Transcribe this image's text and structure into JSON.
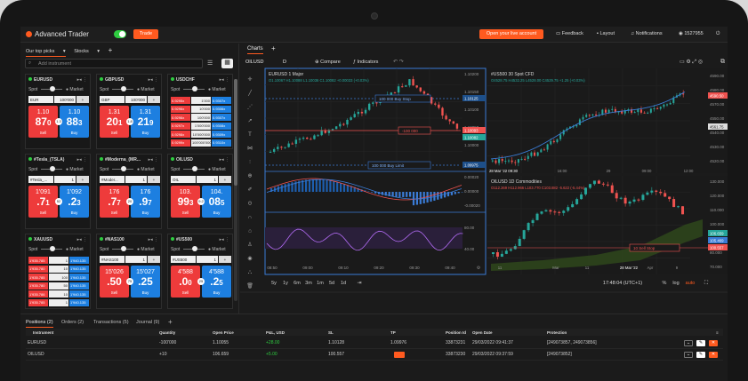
{
  "topbar": {
    "brand": "Advanced Trader",
    "trade_btn": "Trade",
    "live_btn": "Open your live account",
    "feedback": "Feedback",
    "layout": "Layout",
    "notifications": "Notifications",
    "account": "1527955"
  },
  "left": {
    "tab1": "Our top picks",
    "tab2": "Stocks",
    "search_placeholder": "Add instrument"
  },
  "cards": [
    {
      "name": "EURUSD",
      "amt": "EUR",
      "qty": "100'000",
      "sell1": "1.10",
      "sell2": "87",
      "sell3": "0",
      "buy1": "1.10",
      "buy2": "88",
      "buy3": "3",
      "spread": "1.3"
    },
    {
      "name": "GBPUSD",
      "amt": "GBP",
      "qty": "100'000",
      "sell1": "1.31",
      "sell2": "20",
      "sell3": "1",
      "buy1": "1.31",
      "buy2": "21",
      "buy3": "9",
      "spread": "1.8"
    },
    {
      "name": "USDCHF",
      "ladder": true
    },
    {
      "name": "#Tesla_(TSLA)",
      "amt": "#Tesla_...",
      "qty": "1",
      "sell1": "1'091",
      "sell2": ".7",
      "sell3": "1",
      "buy1": "1'092",
      "buy2": ".2",
      "buy3": "3",
      "spread": "52"
    },
    {
      "name": "#Moderna_(MR...",
      "amt": "#Moder...",
      "qty": "1",
      "sell1": "176",
      "sell2": ".7",
      "sell3": "7",
      "buy1": "176",
      "buy2": ".9",
      "buy3": "7",
      "spread": "20"
    },
    {
      "name": "OILUSD",
      "amt": "OIL",
      "qty": "1",
      "sell1": "103.",
      "sell2": "99",
      "sell3": "3",
      "buy1": "104.",
      "buy2": "08",
      "buy3": "5",
      "spread": "9.2"
    },
    {
      "name": "XAUUSD",
      "ladder": true
    },
    {
      "name": "#NAS100",
      "amt": "#NAS100",
      "qty": "1",
      "sell1": "15'026",
      "sell2": ".50",
      "sell3": "",
      "buy1": "15'027",
      "buy2": ".25",
      "buy3": "",
      "spread": "75"
    },
    {
      "name": "#US500",
      "amt": "#US500",
      "qty": "1",
      "sell1": "4'588",
      "sell2": ".0",
      "sell3": "0",
      "buy1": "4'588",
      "buy2": ".2",
      "buy3": "5",
      "spread": "25"
    }
  ],
  "ladder_usdchf": [
    [
      "0.9295x",
      "1'000",
      "0.9307x"
    ],
    [
      "0.9296x",
      "10'000",
      "0.9306x"
    ],
    [
      "0.9296x",
      "100'000",
      "0.9307x"
    ],
    [
      "0.9297x",
      "1'000'000",
      "0.9308x"
    ],
    [
      "0.9298x",
      "10'000'000",
      "0.9309x"
    ],
    [
      "0.9299x",
      "100'000'000",
      "0.9310x"
    ]
  ],
  "ladder_xau": [
    [
      "1'935.785",
      "1",
      "1'940.135"
    ],
    [
      "1'935.780",
      "10",
      "1'940.135"
    ],
    [
      "1'935.785",
      "100",
      "1'940.135"
    ],
    [
      "1'935.780",
      "50",
      "1'940.135"
    ],
    [
      "1'935.786",
      "10",
      "1'940.135"
    ],
    [
      "1'935.785",
      "1",
      "1'940.135"
    ]
  ],
  "charts_tab": "Charts",
  "toolbar": {
    "symbol": "OILUSD",
    "interval": "D",
    "compare": "Compare",
    "indicators": "Indicators"
  },
  "chart1": {
    "title": "EURUSD  1  Major",
    "ohlc": "O1.10067 H1.10088 L1.10036 C1.10082 +0.00033 (+0.03%)",
    "buy_stop": "100 000  Buy Stop",
    "limit": "-100 000",
    "buy_limit": "100 000  Buy Limit",
    "yaxis": [
      "1.10200",
      "1.10150",
      "1.10100",
      "1.10050",
      "1.10000",
      "1.09950"
    ],
    "xaxis": [
      "08:50",
      "09:00",
      "09:10",
      "09:20",
      "09:30",
      "09:40"
    ],
    "tag_a": "1.10125",
    "tag_b": "1.10093",
    "tag_c": "1.10082",
    "tag_d": "1.09975",
    "macd_y": [
      "0.00020",
      "0.00000",
      "-0.00020"
    ],
    "rsi_y": [
      "80.00",
      "40.00"
    ]
  },
  "chart2": {
    "title": "#US500  30  Spot CFD",
    "ohlc": "O4528.75 H4532.25 L4528.00 C4529.75 +1.25 (+0.03%)",
    "yaxis": [
      "4590.00",
      "4580.00",
      "4570.00",
      "4550.00",
      "4540.00",
      "4530.00",
      "4520.00"
    ],
    "tags": [
      "4590.50",
      "4561.75"
    ],
    "xaxis": [
      "28 Mar '22 09:30",
      "16:00",
      "29",
      "09:00",
      "12:00"
    ]
  },
  "chart3": {
    "title": "OILUSD  1D  Commodities",
    "ohlc": "O112.269 H112.966 L103.770 C103.882 -5.622 (-5.44%)",
    "yaxis": [
      "130.000",
      "120.000",
      "110.000",
      "100.000",
      "90.000",
      "80.000",
      "70.000"
    ],
    "tags": [
      "106.659",
      "105.469",
      "100.557"
    ],
    "sellstop": "10  Sell Stop",
    "xaxis": [
      "11",
      "Mar",
      "11",
      "28 Mar '22",
      "Apr",
      "9"
    ]
  },
  "bottom": {
    "periods": [
      "5y",
      "1y",
      "6m",
      "3m",
      "1m",
      "5d",
      "1d"
    ],
    "time": "17:48:04 (UTC+1)",
    "pct": "%",
    "log": "log",
    "auto": "auto"
  },
  "positions": {
    "tabs": [
      "Positions (2)",
      "Orders (2)",
      "Transactions (5)",
      "Journal (9)"
    ],
    "headers": [
      "Instrument",
      "Quantity",
      "Open Price",
      "P&L, USD",
      "SL",
      "TP",
      "Position Id",
      "Open Date",
      "Protection"
    ],
    "rows": [
      [
        "EURUSD",
        "-100'000",
        "1.10055",
        "+28.00",
        "1.10128",
        "1.09976",
        "33873231",
        "29/03/2022 09:41:37",
        "[249073857, 249073856]"
      ],
      [
        "OILUSD",
        "+10",
        "106.659",
        "+5.00",
        "100.557",
        "",
        "33873230",
        "29/03/2022 09:37:59",
        "[249073852]"
      ]
    ]
  }
}
